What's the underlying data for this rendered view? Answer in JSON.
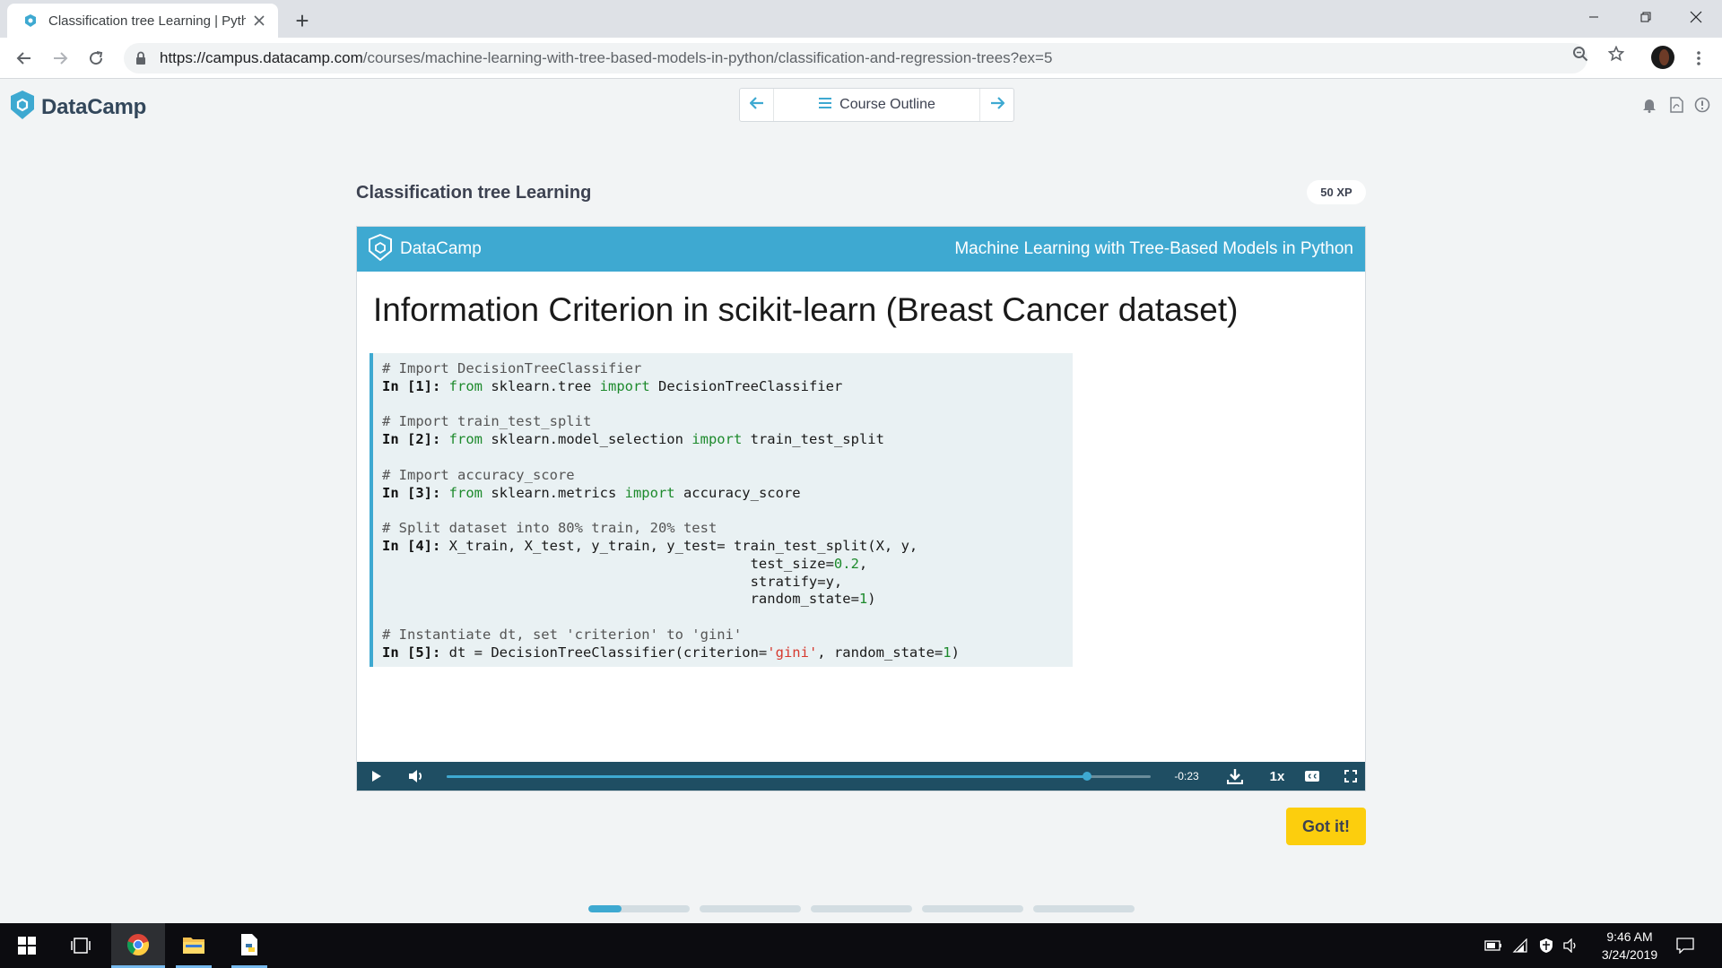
{
  "browser": {
    "tab_title": "Classification tree Learning | Pyth",
    "new_tab_symbol": "+",
    "url_host": "https://campus.datacamp.com",
    "url_path": "/courses/machine-learning-with-tree-based-models-in-python/classification-and-regression-trees?ex=5"
  },
  "header": {
    "logo_text": "DataCamp",
    "outline_label": "Course Outline"
  },
  "exercise": {
    "title": "Classification tree Learning",
    "xp": "50 XP"
  },
  "slide": {
    "brand": "DataCamp",
    "course": "Machine Learning with Tree-Based Models in Python",
    "title": "Information Criterion in scikit-learn (Breast Cancer dataset)",
    "code": [
      "# Import DecisionTreeClassifier",
      "In [1]: from sklearn.tree import DecisionTreeClassifier",
      "",
      "# Import train_test_split",
      "In [2]: from sklearn.model_selection import train_test_split",
      "",
      "# Import accuracy_score",
      "In [3]: from sklearn.metrics import accuracy_score",
      "",
      "# Split dataset into 80% train, 20% test",
      "In [4]: X_train, X_test, y_train, y_test= train_test_split(X, y,",
      "                                            test_size=0.2,",
      "                                            stratify=y,",
      "                                            random_state=1)",
      "",
      "# Instantiate dt, set 'criterion' to 'gini'",
      "In [5]: dt = DecisionTreeClassifier(criterion='gini', random_state=1)"
    ]
  },
  "player": {
    "time_remaining": "-0:23",
    "speed": "1x",
    "progress_fraction": 0.91,
    "accent_color": "#3ea9d1"
  },
  "actions": {
    "got_it": "Got it!"
  },
  "steps": {
    "count": 5,
    "first_step_progress": 0.33
  },
  "taskbar": {
    "time": "9:46 AM",
    "date": "3/24/2019"
  }
}
